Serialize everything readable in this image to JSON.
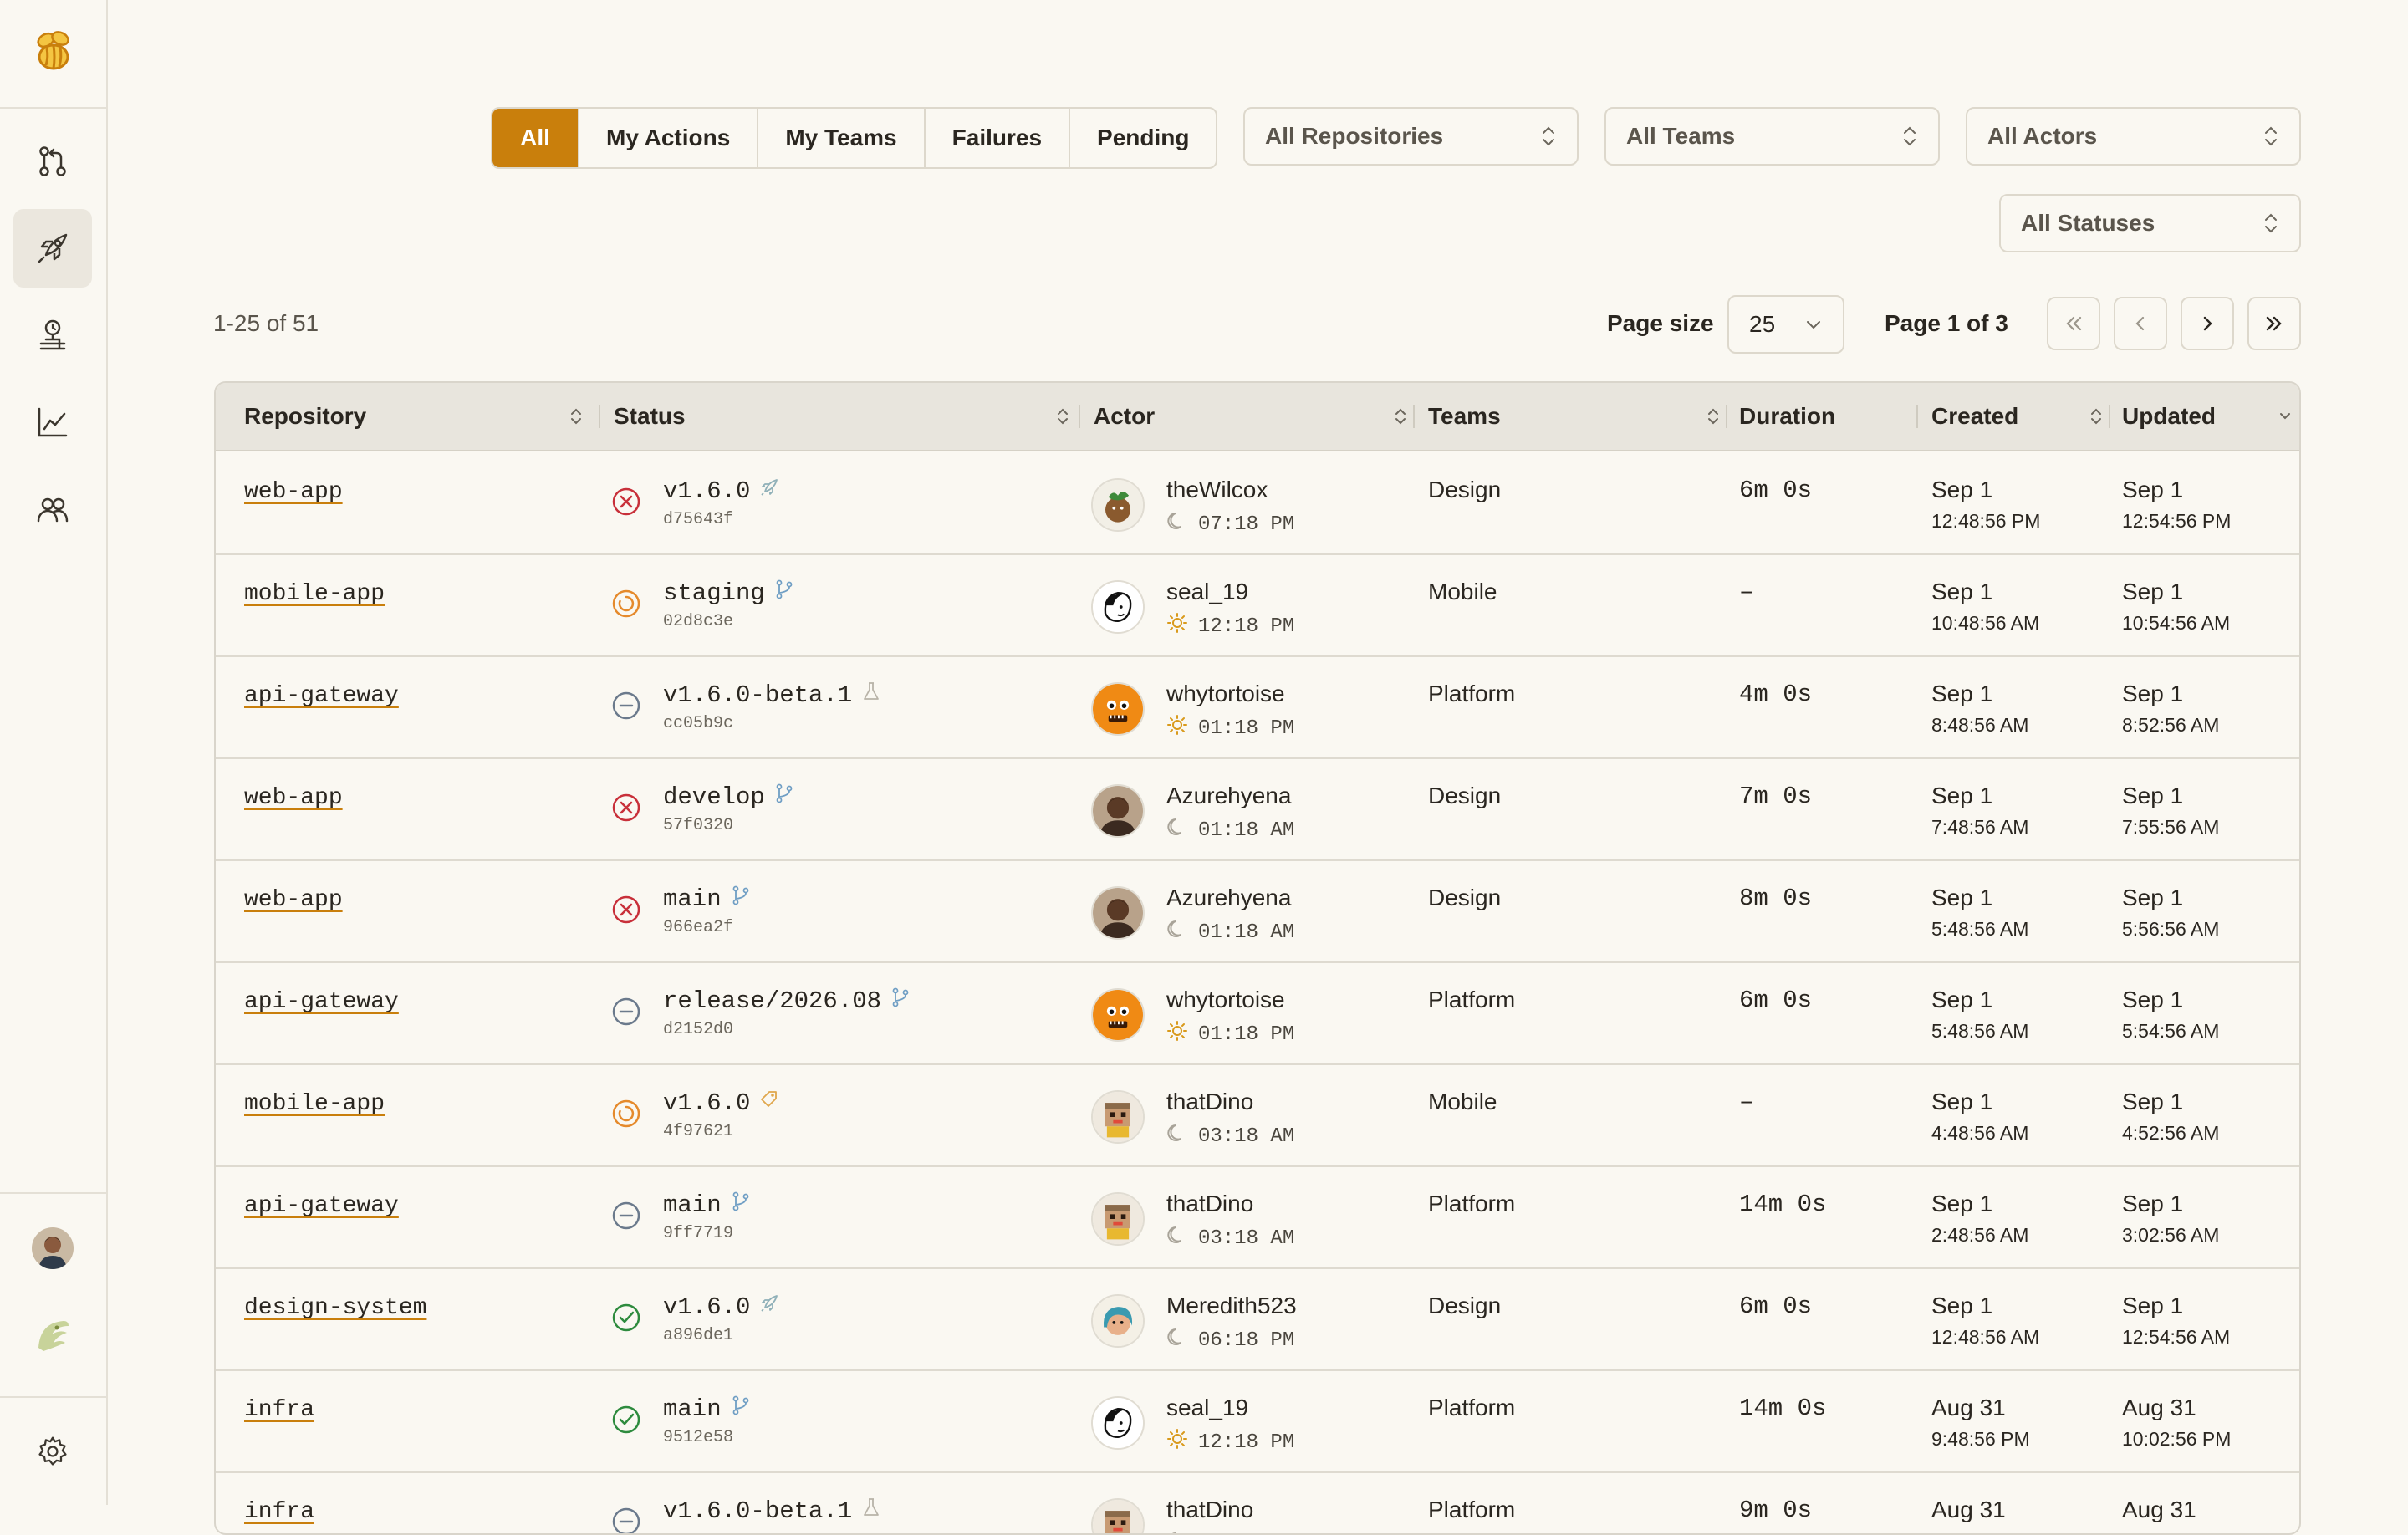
{
  "filters": {
    "tabs": [
      {
        "label": "All",
        "active": true
      },
      {
        "label": "My Actions",
        "active": false
      },
      {
        "label": "My Teams",
        "active": false
      },
      {
        "label": "Failures",
        "active": false
      },
      {
        "label": "Pending",
        "active": false
      }
    ],
    "repositories": "All Repositories",
    "teams": "All Teams",
    "actors": "All Actors",
    "statuses": "All Statuses"
  },
  "pagination": {
    "range": "1-25 of 51",
    "page_size_label": "Page size",
    "page_size": "25",
    "page_of": "Page 1 of 3"
  },
  "table": {
    "headers": {
      "repository": "Repository",
      "status": "Status",
      "actor": "Actor",
      "teams": "Teams",
      "duration": "Duration",
      "created": "Created",
      "updated": "Updated"
    },
    "rows": [
      {
        "repo": "web-app",
        "status": "failed",
        "ref": "v1.6.0",
        "ref_icon": "rocket-icon",
        "sha": "d75643f",
        "actor": "theWilcox",
        "avatar": "plant",
        "time_icon": "moon-icon",
        "time": "07:18 PM",
        "team": "Design",
        "duration": "6m 0s",
        "created_date": "Sep 1",
        "created_time": "12:48:56 PM",
        "updated_date": "Sep 1",
        "updated_time": "12:54:56 PM"
      },
      {
        "repo": "mobile-app",
        "status": "running",
        "ref": "staging",
        "ref_icon": "branch-icon",
        "sha": "02d8c3e",
        "actor": "seal_19",
        "avatar": "sketch",
        "time_icon": "sun-icon",
        "time": "12:18 PM",
        "team": "Mobile",
        "duration": "–",
        "created_date": "Sep 1",
        "created_time": "10:48:56 AM",
        "updated_date": "Sep 1",
        "updated_time": "10:54:56 AM"
      },
      {
        "repo": "api-gateway",
        "status": "skipped",
        "ref": "v1.6.0-beta.1",
        "ref_icon": "flask-icon",
        "sha": "cc05b9c",
        "actor": "whytortoise",
        "avatar": "orange",
        "time_icon": "sun-icon",
        "time": "01:18 PM",
        "team": "Platform",
        "duration": "4m 0s",
        "created_date": "Sep 1",
        "created_time": "8:48:56 AM",
        "updated_date": "Sep 1",
        "updated_time": "8:52:56 AM"
      },
      {
        "repo": "web-app",
        "status": "failed",
        "ref": "develop",
        "ref_icon": "branch-icon",
        "sha": "57f0320",
        "actor": "Azurehyena",
        "avatar": "photo",
        "time_icon": "moon-icon",
        "time": "01:18 AM",
        "team": "Design",
        "duration": "7m 0s",
        "created_date": "Sep 1",
        "created_time": "7:48:56 AM",
        "updated_date": "Sep 1",
        "updated_time": "7:55:56 AM"
      },
      {
        "repo": "web-app",
        "status": "failed",
        "ref": "main",
        "ref_icon": "branch-icon",
        "sha": "966ea2f",
        "actor": "Azurehyena",
        "avatar": "photo",
        "time_icon": "moon-icon",
        "time": "01:18 AM",
        "team": "Design",
        "duration": "8m 0s",
        "created_date": "Sep 1",
        "created_time": "5:48:56 AM",
        "updated_date": "Sep 1",
        "updated_time": "5:56:56 AM"
      },
      {
        "repo": "api-gateway",
        "status": "skipped",
        "ref": "release/2026.08",
        "ref_icon": "branch-icon",
        "sha": "d2152d0",
        "actor": "whytortoise",
        "avatar": "orange",
        "time_icon": "sun-icon",
        "time": "01:18 PM",
        "team": "Platform",
        "duration": "6m 0s",
        "created_date": "Sep 1",
        "created_time": "5:48:56 AM",
        "updated_date": "Sep 1",
        "updated_time": "5:54:56 AM"
      },
      {
        "repo": "mobile-app",
        "status": "running",
        "ref": "v1.6.0",
        "ref_icon": "tag-icon",
        "sha": "4f97621",
        "actor": "thatDino",
        "avatar": "pixel",
        "time_icon": "moon-icon",
        "time": "03:18 AM",
        "team": "Mobile",
        "duration": "–",
        "created_date": "Sep 1",
        "created_time": "4:48:56 AM",
        "updated_date": "Sep 1",
        "updated_time": "4:52:56 AM"
      },
      {
        "repo": "api-gateway",
        "status": "skipped",
        "ref": "main",
        "ref_icon": "branch-icon",
        "sha": "9ff7719",
        "actor": "thatDino",
        "avatar": "pixel",
        "time_icon": "moon-icon",
        "time": "03:18 AM",
        "team": "Platform",
        "duration": "14m 0s",
        "created_date": "Sep 1",
        "created_time": "2:48:56 AM",
        "updated_date": "Sep 1",
        "updated_time": "3:02:56 AM"
      },
      {
        "repo": "design-system",
        "status": "success",
        "ref": "v1.6.0",
        "ref_icon": "rocket-icon",
        "sha": "a896de1",
        "actor": "Meredith523",
        "avatar": "teal",
        "time_icon": "moon-icon",
        "time": "06:18 PM",
        "team": "Design",
        "duration": "6m 0s",
        "created_date": "Sep 1",
        "created_time": "12:48:56 AM",
        "updated_date": "Sep 1",
        "updated_time": "12:54:56 AM"
      },
      {
        "repo": "infra",
        "status": "success",
        "ref": "main",
        "ref_icon": "branch-icon",
        "sha": "9512e58",
        "actor": "seal_19",
        "avatar": "sketch",
        "time_icon": "sun-icon",
        "time": "12:18 PM",
        "team": "Platform",
        "duration": "14m 0s",
        "created_date": "Aug 31",
        "created_time": "9:48:56 PM",
        "updated_date": "Aug 31",
        "updated_time": "10:02:56 PM"
      },
      {
        "repo": "infra",
        "status": "skipped",
        "ref": "v1.6.0-beta.1",
        "ref_icon": "flask-icon",
        "sha": "",
        "actor": "thatDino",
        "avatar": "pixel",
        "time_icon": "moon-icon",
        "time": "",
        "team": "Platform",
        "duration": "9m 0s",
        "created_date": "Aug 31",
        "created_time": "",
        "updated_date": "Aug 31",
        "updated_time": ""
      }
    ]
  },
  "colors": {
    "accent": "#c97f0c",
    "failed": "#c8303a",
    "running": "#e58a2c",
    "skipped": "#6b7a8c",
    "success": "#2e8b3e"
  }
}
